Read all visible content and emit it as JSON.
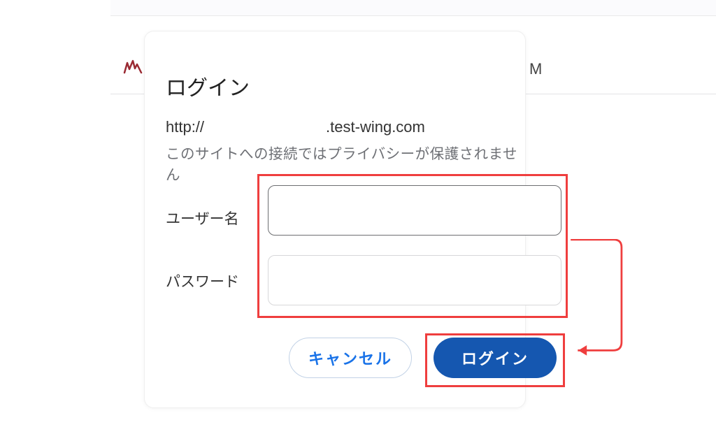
{
  "background": {
    "nav_letter": "M"
  },
  "dialog": {
    "title": "ログイン",
    "url_prefix": "http://",
    "url_suffix": ".test-wing.com",
    "message": "このサイトへの接続ではプライバシーが保護されません",
    "username_label": "ユーザー名",
    "password_label": "パスワード",
    "username_value": "",
    "password_value": "",
    "cancel_label": "キャンセル",
    "login_label": "ログイン"
  }
}
